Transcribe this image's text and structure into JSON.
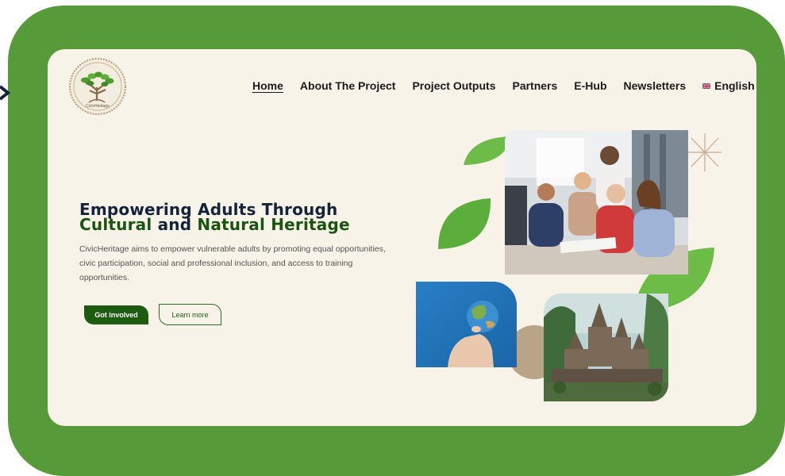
{
  "header": {
    "logo_text": "CivicHeritage",
    "nav": [
      {
        "label": "Home",
        "active": true
      },
      {
        "label": "About The Project"
      },
      {
        "label": "Project Outputs"
      },
      {
        "label": "Partners"
      },
      {
        "label": "E-Hub"
      },
      {
        "label": "Newsletters"
      }
    ],
    "language": {
      "label": "English",
      "flag": "uk-flag-icon"
    }
  },
  "hero": {
    "title_line1": "Empowering Adults Through",
    "title_line2_a": "Cultural",
    "title_line2_b": "and",
    "title_line2_c": "Natural Heritage",
    "description": "CivicHeritage aims to empower vulnerable adults by promoting equal opportunities, civic participation, social and professional inclusion, and access to training opportunities.",
    "primary_button": "Got involved",
    "secondary_button": "Learn more"
  },
  "colors": {
    "frame_green": "#579a3a",
    "background": "#f8f3e9",
    "leaf_green": "#6cbc47",
    "dark_green": "#1c5b10",
    "navy": "#13233a",
    "blue_panel": "#1e6fb4",
    "taupe": "#b9a487"
  },
  "images": {
    "team_photo": "people-collaborating-photo",
    "globe_photo": "hand-holding-globe-photo",
    "temple_photo": "ancient-temple-photo"
  }
}
